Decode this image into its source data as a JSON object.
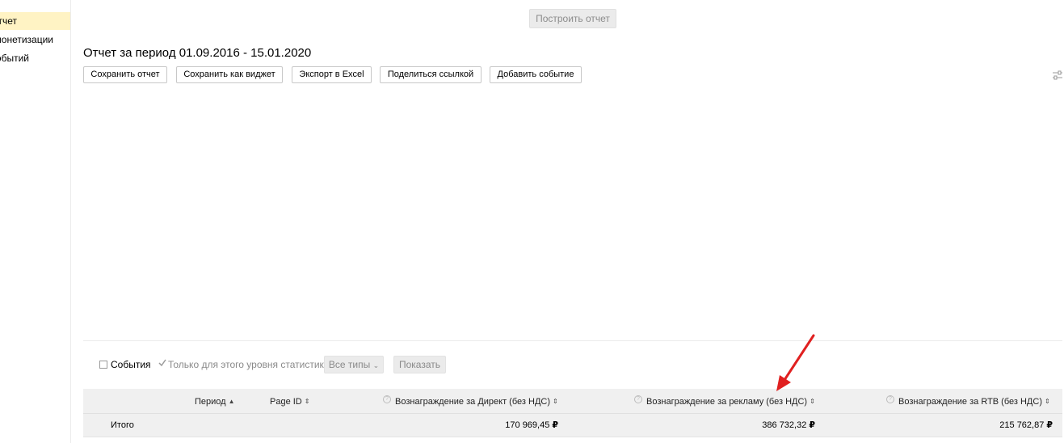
{
  "sidebar": {
    "items": [
      {
        "label": "тчет",
        "active": true
      },
      {
        "label": "монетизации",
        "active": false
      },
      {
        "label": "обытий",
        "active": false
      }
    ]
  },
  "toolbar": {
    "build_label": "Построить отчет"
  },
  "report": {
    "title": "Отчет за период 01.09.2016 - 15.01.2020",
    "buttons": {
      "save": "Сохранить отчет",
      "save_widget": "Сохранить как виджет",
      "export_excel": "Экспорт в Excel",
      "share_link": "Поделиться ссылкой",
      "add_event": "Добавить событие"
    }
  },
  "filters": {
    "events_label": "События",
    "events_checked": false,
    "level_only_label": "Только для этого уровня статистики",
    "level_only_checked": true,
    "types_select": "Все типы",
    "show_label": "Показать"
  },
  "table": {
    "columns": {
      "period": "Период",
      "page_id": "Page ID",
      "direct": "Вознаграждение за Директ (без НДС)",
      "ads": "Вознаграждение за рекламу (без НДС)",
      "rtb": "Вознаграждение за RTB (без НДС)"
    },
    "total": {
      "label": "Итого",
      "direct": "170 969,45",
      "ads": "386 732,32",
      "rtb": "215 762,87",
      "currency": "₽"
    }
  },
  "colors": {
    "active_sidebar": "#fff3c4",
    "annotation_arrow": "#e02020"
  }
}
